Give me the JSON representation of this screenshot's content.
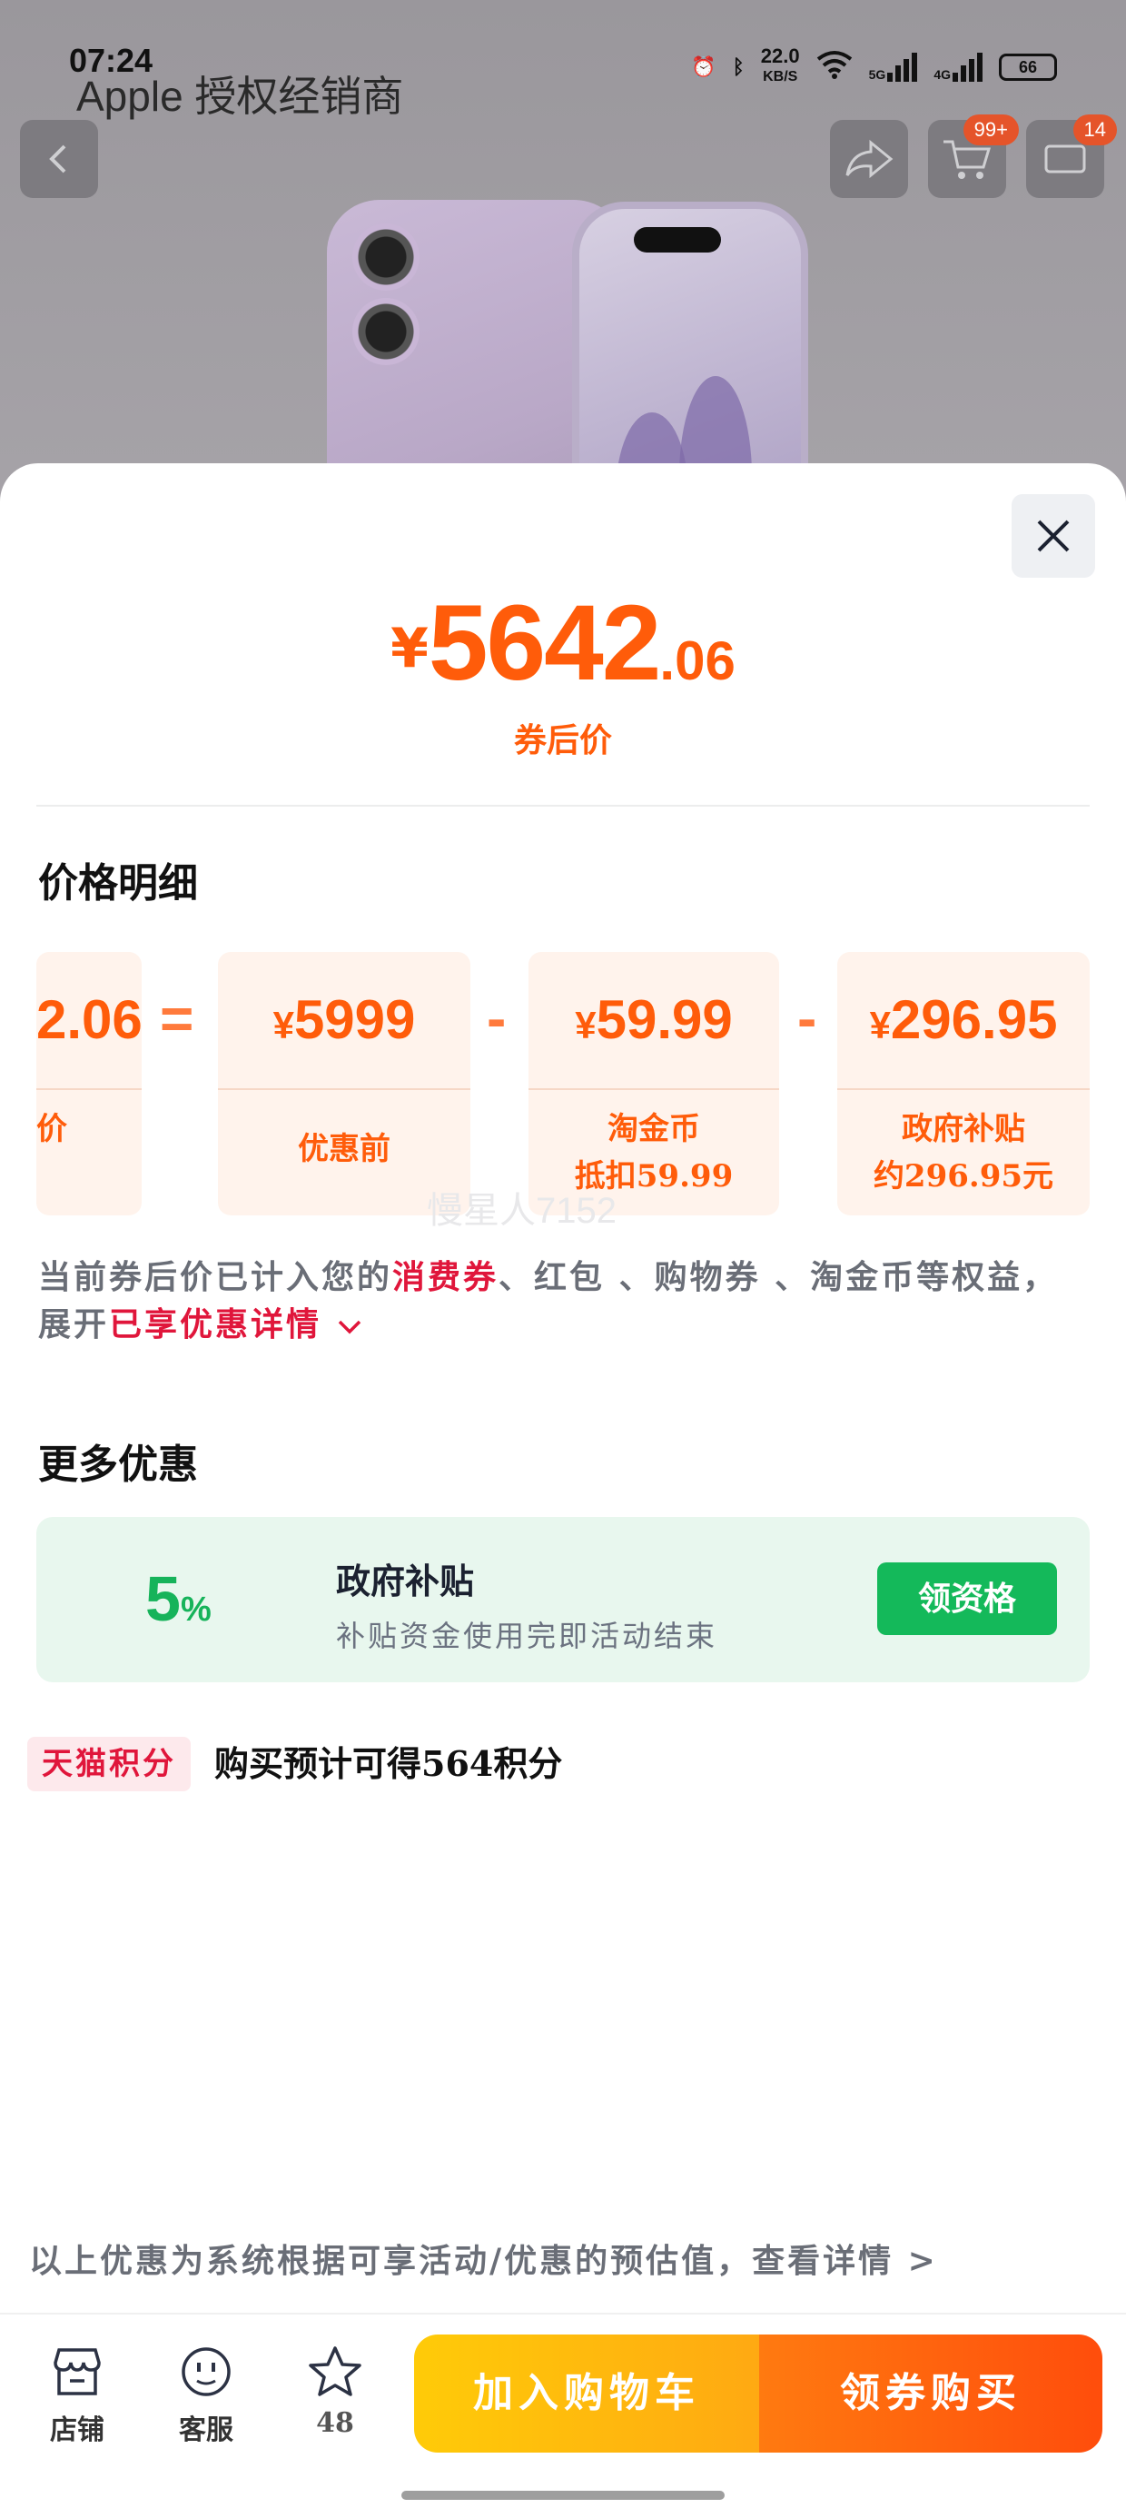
{
  "status_bar": {
    "time": "07:24",
    "network_speed": "22.0",
    "network_unit": "KB/S",
    "sig1": "5G",
    "sig2": "4G",
    "battery": "66"
  },
  "store_title": "Apple 授权经销商",
  "nav": {
    "cart_badge": "99+",
    "more_badge": "14"
  },
  "price": {
    "currency": "¥",
    "integer": "5642",
    "decimal": ".06",
    "label": "券后价"
  },
  "breakdown": {
    "title": "价格明细",
    "result_partial": "2.06",
    "result_label_partial": "价",
    "equals": "=",
    "minus": "-",
    "items": [
      {
        "symbol": "¥",
        "amount": "5999",
        "label1": "优惠前",
        "label2": ""
      },
      {
        "symbol": "¥",
        "amount": "59.99",
        "label1": "淘金币",
        "label2": "抵扣59.99"
      },
      {
        "symbol": "¥",
        "amount": "296.95",
        "label1": "政府补贴",
        "label2": "约296.95元"
      }
    ]
  },
  "watermark": "慢星人7152",
  "note": {
    "part1": "当前券后价已计入您的",
    "highlight1": "消费券",
    "part2": "、红包 、购物券 、淘金币等权益，",
    "part3": "展开",
    "highlight2": "已享优惠详情"
  },
  "more_offers": {
    "title": "更多优惠",
    "card": {
      "percent_number": "5",
      "percent_sign": "%",
      "title": "政府补贴",
      "desc": "补贴资金使用完即活动结束",
      "button": "领资格"
    }
  },
  "points": {
    "tag": "天猫积分",
    "text": "购买预计可得564积分"
  },
  "footer_note": "以上优惠为系统根据可享活动/优惠的预估值，查看详情 >",
  "bottom_bar": {
    "store": "店铺",
    "service": "客服",
    "favorites_count": "48",
    "add_cart": "加入购物车",
    "buy": "领券购买"
  },
  "colors": {
    "accent_orange": "#ff5c0a",
    "highlight_red": "#e0163b",
    "green": "#14b95a"
  }
}
